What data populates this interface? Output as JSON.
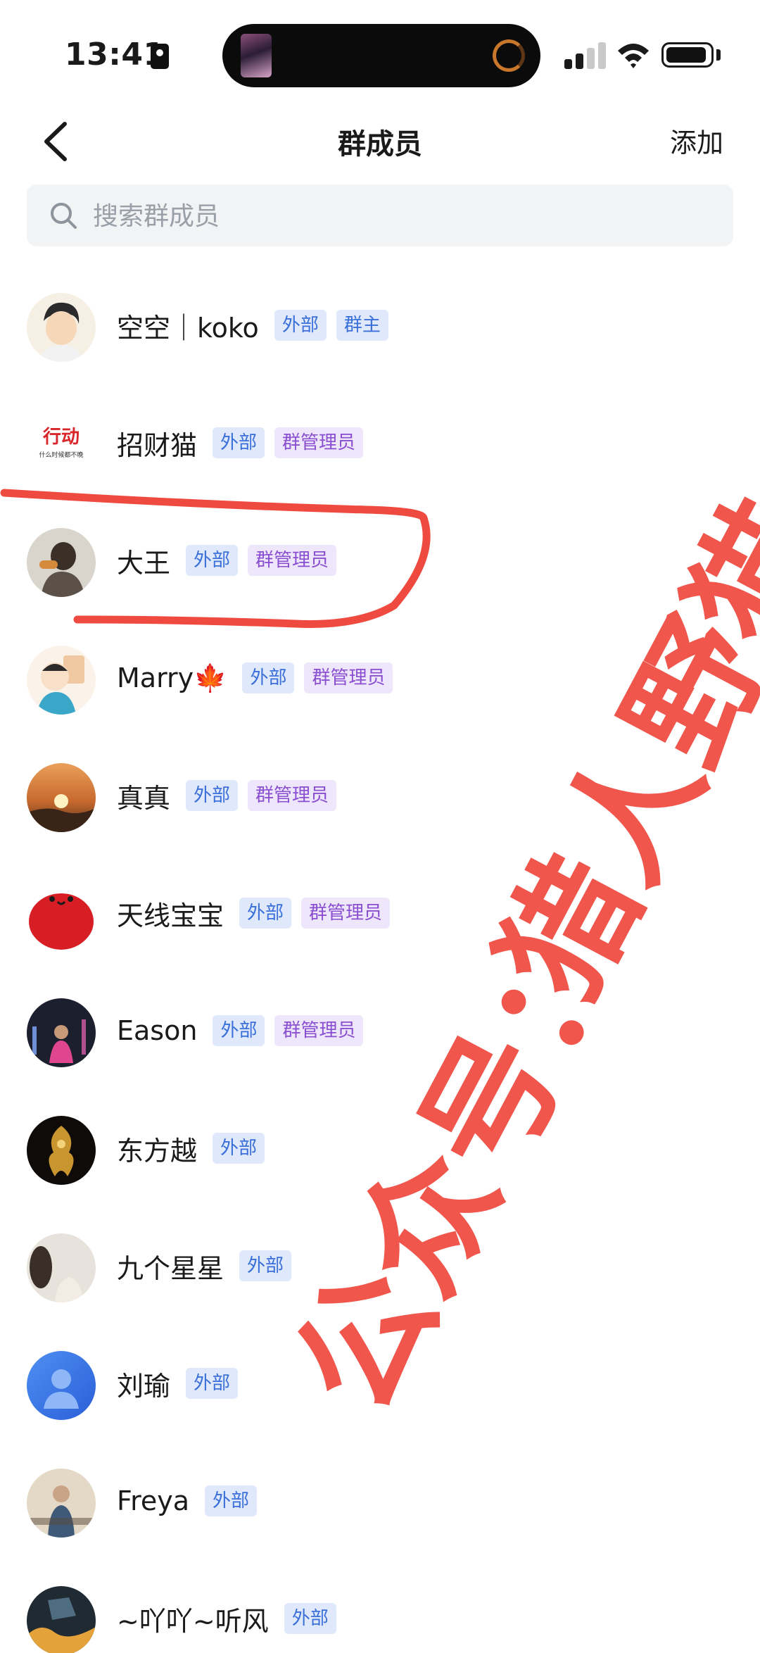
{
  "status_bar": {
    "time": "13:41"
  },
  "nav": {
    "title": "群成员",
    "action": "添加"
  },
  "search": {
    "placeholder": "搜索群成员"
  },
  "members": [
    {
      "name": "空空｜koko",
      "tags": [
        "外部",
        "群主"
      ]
    },
    {
      "name": "招财猫",
      "tags": [
        "外部",
        "群管理员"
      ],
      "avatar_text": [
        "行动",
        "什么时候都不晚"
      ]
    },
    {
      "name": "大王",
      "tags": [
        "外部",
        "群管理员"
      ]
    },
    {
      "name": "Marry🍁",
      "tags": [
        "外部",
        "群管理员"
      ]
    },
    {
      "name": "真真",
      "tags": [
        "外部",
        "群管理员"
      ]
    },
    {
      "name": "天线宝宝",
      "tags": [
        "外部",
        "群管理员"
      ]
    },
    {
      "name": "Eason",
      "tags": [
        "外部",
        "群管理员"
      ]
    },
    {
      "name": "东方越",
      "tags": [
        "外部"
      ]
    },
    {
      "name": "九个星星",
      "tags": [
        "外部"
      ]
    },
    {
      "name": "刘瑜",
      "tags": [
        "外部"
      ]
    },
    {
      "name": "Freya",
      "tags": [
        "外部"
      ]
    },
    {
      "name": "~吖吖~听风",
      "tags": [
        "外部"
      ]
    }
  ],
  "overlay": {
    "watermark_line1": "公众号：",
    "watermark_line2": "猎人野猫",
    "color": "#ef4a3f"
  },
  "colors": {
    "tag_external_bg": "#dfe9fb",
    "tag_external_fg": "#3a6fd9",
    "tag_admin_bg": "#eee6fa",
    "tag_admin_fg": "#8a4fd1"
  }
}
